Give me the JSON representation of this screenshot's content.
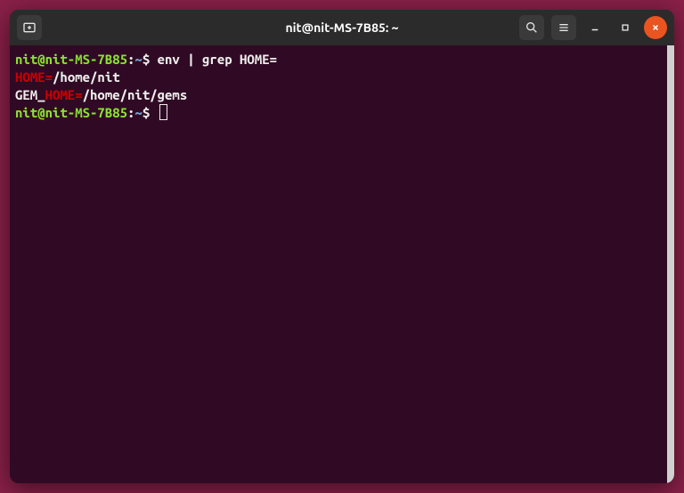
{
  "window": {
    "title": "nit@nit-MS-7B85: ~"
  },
  "prompt": {
    "user_host": "nit@nit-MS-7B85",
    "colon": ":",
    "path": "~",
    "dollar": "$"
  },
  "lines": {
    "cmd1": " env | grep HOME=",
    "out1_hl": "HOME=",
    "out1_rest": "/home/nit",
    "out2_pre": "GEM_",
    "out2_hl": "HOME=",
    "out2_rest": "/home/nit/gems"
  },
  "icons": {
    "new_tab": "new-tab-icon",
    "search": "search-icon",
    "menu": "hamburger-icon",
    "minimize": "minimize-icon",
    "maximize": "maximize-icon",
    "close": "close-icon"
  }
}
